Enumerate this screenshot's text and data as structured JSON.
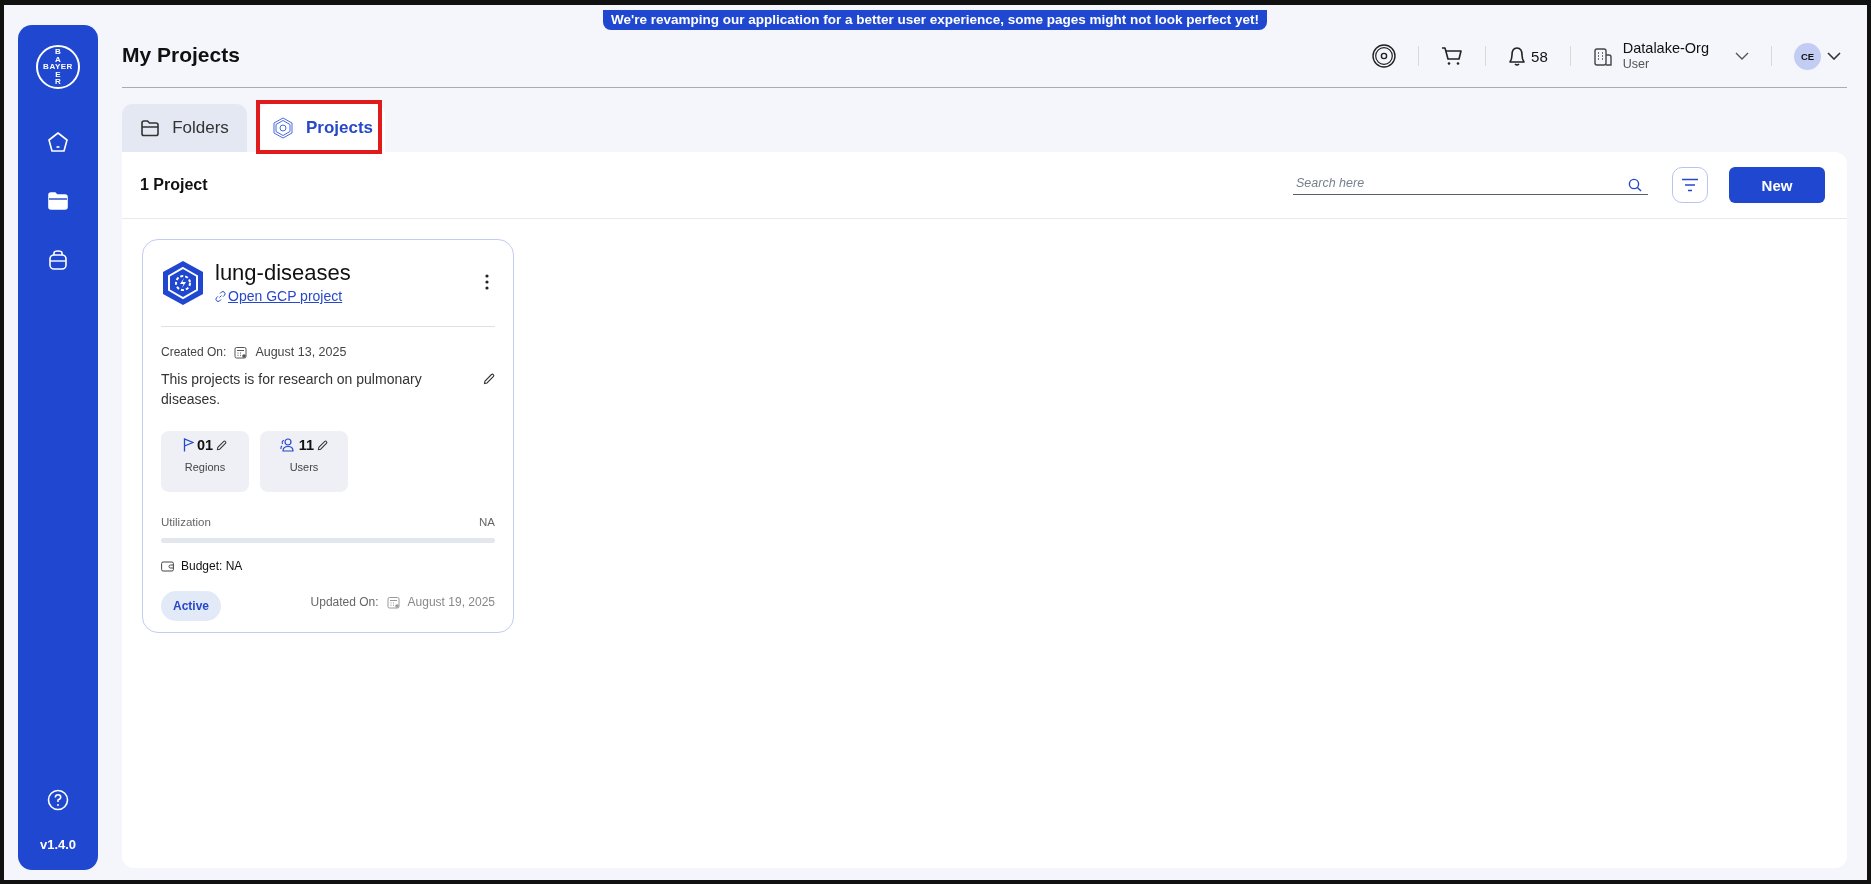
{
  "banner": "We're revamping our application for a better user experience, some pages might not look perfect yet!",
  "sidebar": {
    "logo": {
      "horizontal": "BAYER",
      "vertical_top": "BA",
      "vertical_bottom": "ER"
    },
    "items": [
      {
        "kind": "home",
        "selected": false
      },
      {
        "kind": "folder",
        "selected": true
      },
      {
        "kind": "bag",
        "selected": false
      }
    ],
    "version": "v1.4.0"
  },
  "header": {
    "title": "My Projects",
    "notifications": "58",
    "org": {
      "name": "Datalake-Org",
      "role": "User"
    },
    "avatar": "CE"
  },
  "tabs": [
    {
      "label": "Folders",
      "kind": "folder",
      "selected": false,
      "highlighted": false
    },
    {
      "label": "Projects",
      "kind": "project",
      "selected": true,
      "highlighted": true
    }
  ],
  "toolbar": {
    "count": "1 Project",
    "search": {
      "placeholder": "Search here"
    },
    "new_button": "New"
  },
  "projects": [
    {
      "name": "lung-diseases",
      "link": "Open GCP project",
      "created_label": "Created On:",
      "created": "August 13, 2025",
      "description": "This projects is for research on pulmonary diseases.",
      "stats": [
        {
          "kind": "regions",
          "value": "01",
          "label": "Regions"
        },
        {
          "kind": "users",
          "value": "11",
          "label": "Users"
        }
      ],
      "utilization": {
        "label": "Utilization",
        "reading": "NA",
        "level": 0
      },
      "budget": "Budget: NA",
      "status": "Active",
      "updated_label": "Updated On:",
      "updated": "August 19, 2025"
    }
  ]
}
